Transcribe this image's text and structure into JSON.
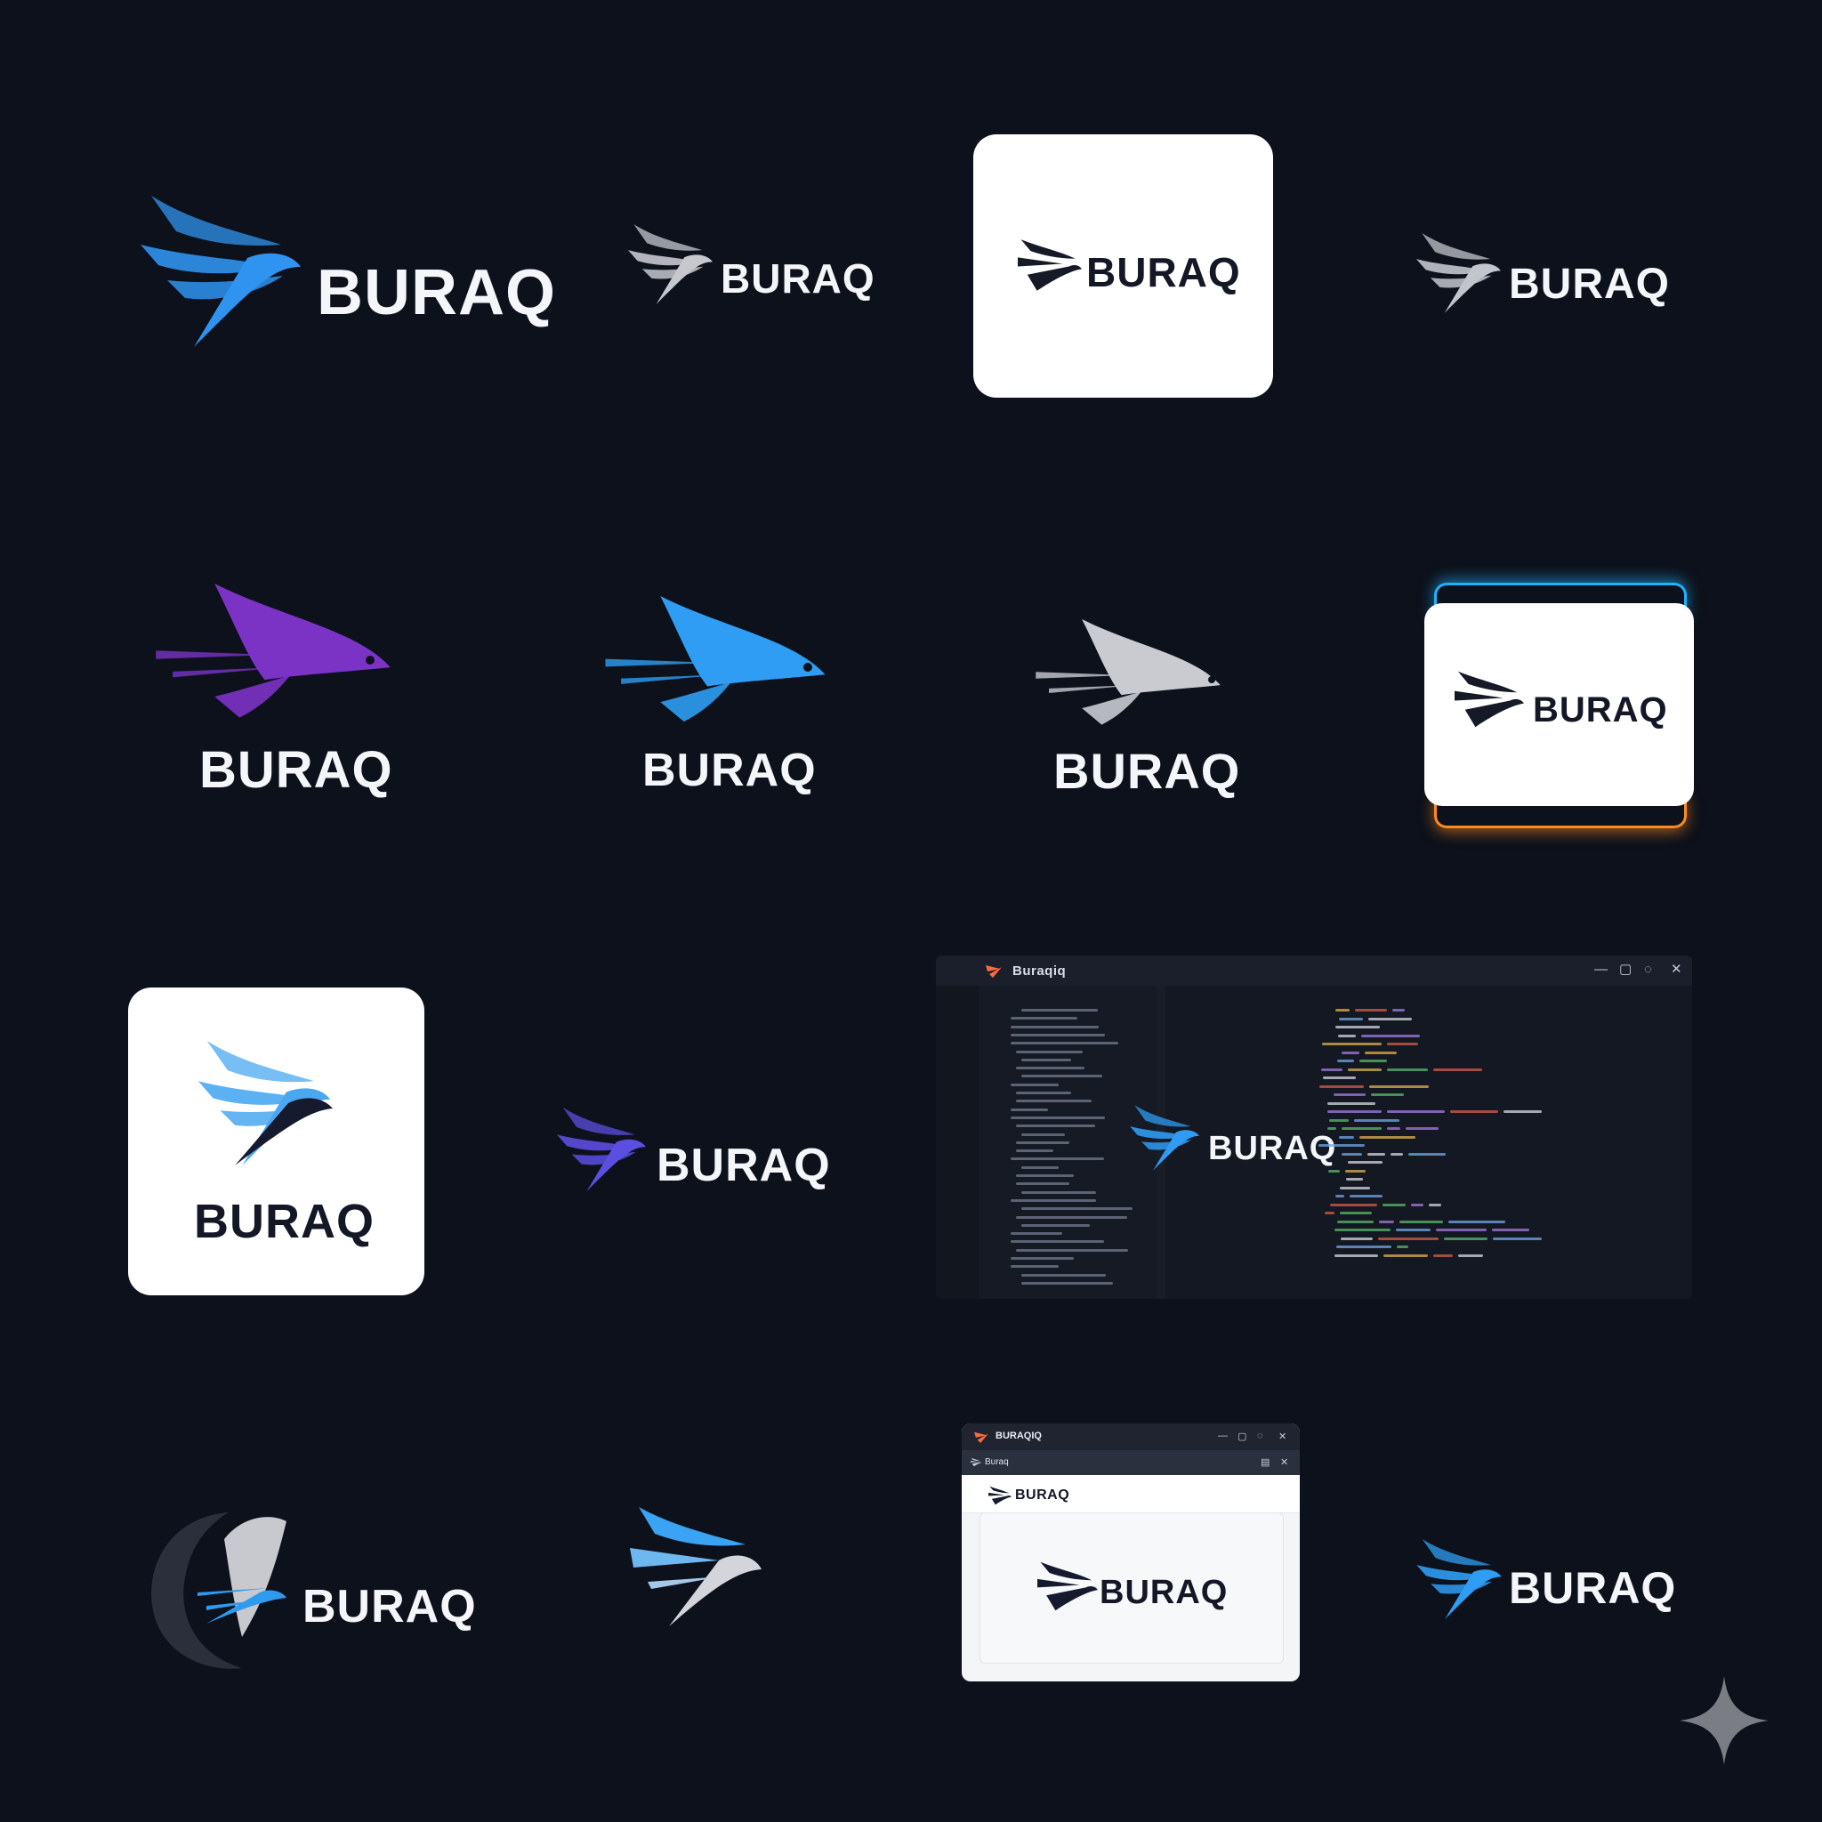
{
  "brand": {
    "wordmark": "BURAQ"
  },
  "colors": {
    "background": "#0d111b",
    "sky_blue": "#36a2f5",
    "deep_blue": "#1f6fd8",
    "purple": "#7b34c4",
    "violet": "#5a4ee0",
    "silver": "#c9cbd1",
    "navy": "#161a2e",
    "glow_blue": "#1fb2ff",
    "glow_orange": "#ff8a1f"
  },
  "variants": [
    {
      "id": "v1",
      "label": "BURAQ"
    },
    {
      "id": "v2",
      "label": "BURAQ"
    },
    {
      "id": "v3",
      "label": "BURAQ"
    },
    {
      "id": "v4",
      "label": "BURAQ"
    },
    {
      "id": "v5",
      "label": "BURAQ"
    },
    {
      "id": "v6",
      "label": "BURAQ"
    },
    {
      "id": "v7",
      "label": "BURAQ"
    },
    {
      "id": "v8",
      "label": "BURAQ"
    },
    {
      "id": "v9",
      "label": "BURAQ"
    },
    {
      "id": "v10",
      "label": "BURAQ"
    },
    {
      "id": "v11",
      "label": "BURAQ"
    },
    {
      "id": "v12",
      "label": "BURAQ"
    },
    {
      "id": "v13",
      "label": "BURAQ"
    },
    {
      "id": "v14",
      "label": "BURAQ"
    }
  ],
  "ide_mock": {
    "title": "Buraqiq",
    "window_controls": [
      "—",
      "▢",
      "◌",
      "✕"
    ],
    "editor_logo": "BURAQ"
  },
  "window_mock": {
    "title": "BURAQIQ",
    "tab_title": "Buraq",
    "header_logo": "BURAQ",
    "body_logo": "BURAQ",
    "window_controls": [
      "—",
      "▢",
      "◌",
      "✕"
    ]
  }
}
